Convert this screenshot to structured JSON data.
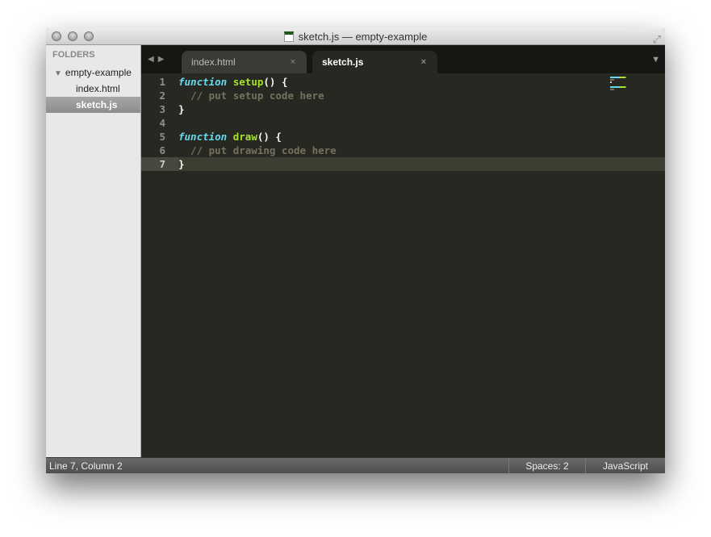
{
  "window": {
    "title": "sketch.js — empty-example"
  },
  "sidebar": {
    "header": "FOLDERS",
    "folder": "empty-example",
    "files": [
      "index.html",
      "sketch.js"
    ],
    "selected": "sketch.js"
  },
  "tabs": [
    {
      "label": "index.html",
      "close": "×"
    },
    {
      "label": "sketch.js",
      "close": "×"
    }
  ],
  "icons": {
    "nav_back": "◀",
    "nav_fwd": "▶",
    "tab_menu": "▼",
    "fold": "▼",
    "fullscreen": "⤢"
  },
  "editor": {
    "lines": [
      {
        "n": "1",
        "kw": "function",
        "fn": "setup",
        "p": "() {",
        "cm": ""
      },
      {
        "n": "2",
        "kw": "",
        "fn": "",
        "p": "",
        "cm": "  // put setup code here"
      },
      {
        "n": "3",
        "kw": "",
        "fn": "",
        "p": "}",
        "cm": ""
      },
      {
        "n": "4",
        "kw": "",
        "fn": "",
        "p": "",
        "cm": ""
      },
      {
        "n": "5",
        "kw": "function",
        "fn": "draw",
        "p": "() {",
        "cm": ""
      },
      {
        "n": "6",
        "kw": "",
        "fn": "",
        "p": "",
        "cm": "  // put drawing code here"
      },
      {
        "n": "7",
        "kw": "",
        "fn": "",
        "p": "}",
        "cm": ""
      }
    ],
    "current_line": 7
  },
  "status": {
    "position": "Line 7, Column 2",
    "indent": "Spaces: 2",
    "syntax": "JavaScript"
  }
}
